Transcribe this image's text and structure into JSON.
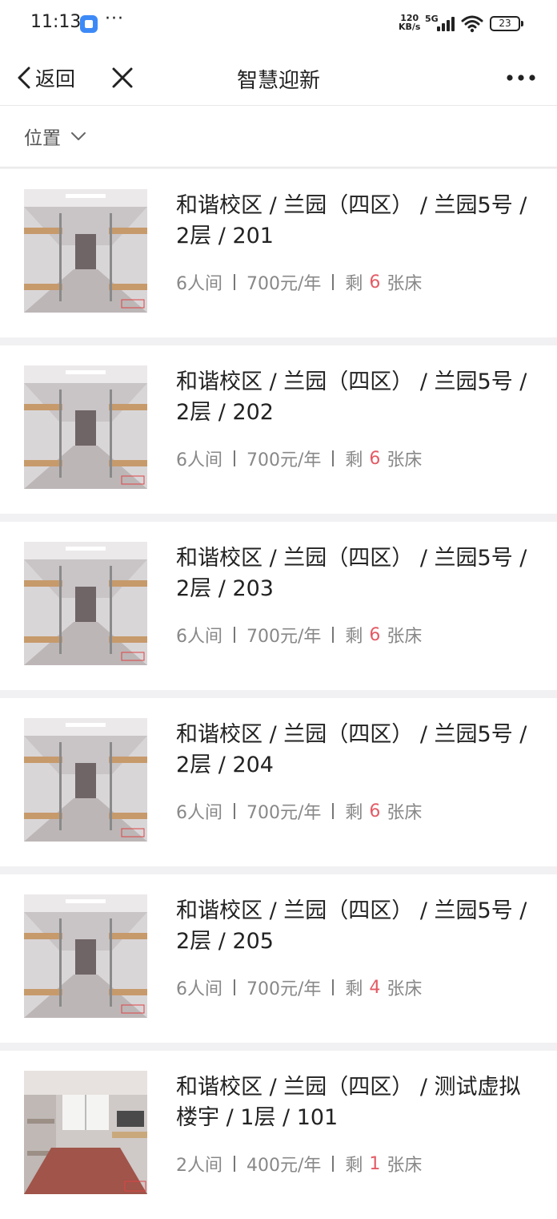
{
  "status_bar": {
    "time": "11:13",
    "more": "···",
    "net_speed_top": "120",
    "net_speed_bottom": "KB/s",
    "network": "5G",
    "battery": "23"
  },
  "nav": {
    "back_label": "返回",
    "title": "智慧迎新"
  },
  "filter": {
    "location_label": "位置"
  },
  "rooms": [
    {
      "title": "和谐校区 / 兰园（四区） / 兰园5号 / 2层 / 201",
      "capacity": "6人间",
      "price": "700元/年",
      "remain_prefix": "剩",
      "remain_count": "6",
      "remain_suffix": "张床",
      "image": "dorm-bunk-photo"
    },
    {
      "title": "和谐校区 / 兰园（四区） / 兰园5号 / 2层 / 202",
      "capacity": "6人间",
      "price": "700元/年",
      "remain_prefix": "剩",
      "remain_count": "6",
      "remain_suffix": "张床",
      "image": "dorm-bunk-photo"
    },
    {
      "title": "和谐校区 / 兰园（四区） / 兰园5号 / 2层 / 203",
      "capacity": "6人间",
      "price": "700元/年",
      "remain_prefix": "剩",
      "remain_count": "6",
      "remain_suffix": "张床",
      "image": "dorm-bunk-photo"
    },
    {
      "title": "和谐校区 / 兰园（四区） / 兰园5号 / 2层 / 204",
      "capacity": "6人间",
      "price": "700元/年",
      "remain_prefix": "剩",
      "remain_count": "6",
      "remain_suffix": "张床",
      "image": "dorm-bunk-photo"
    },
    {
      "title": "和谐校区 / 兰园（四区） / 兰园5号 / 2层 / 205",
      "capacity": "6人间",
      "price": "700元/年",
      "remain_prefix": "剩",
      "remain_count": "4",
      "remain_suffix": "张床",
      "image": "dorm-bunk-photo"
    },
    {
      "title": "和谐校区 / 兰园（四区） / 测试虚拟楼宇 / 1层 / 101",
      "capacity": "2人间",
      "price": "400元/年",
      "remain_prefix": "剩",
      "remain_count": "1",
      "remain_suffix": "张床",
      "image": "dorm-loft-photo"
    }
  ],
  "colors": {
    "accent_red": "#e35b65",
    "background": "#f1f1f3"
  }
}
